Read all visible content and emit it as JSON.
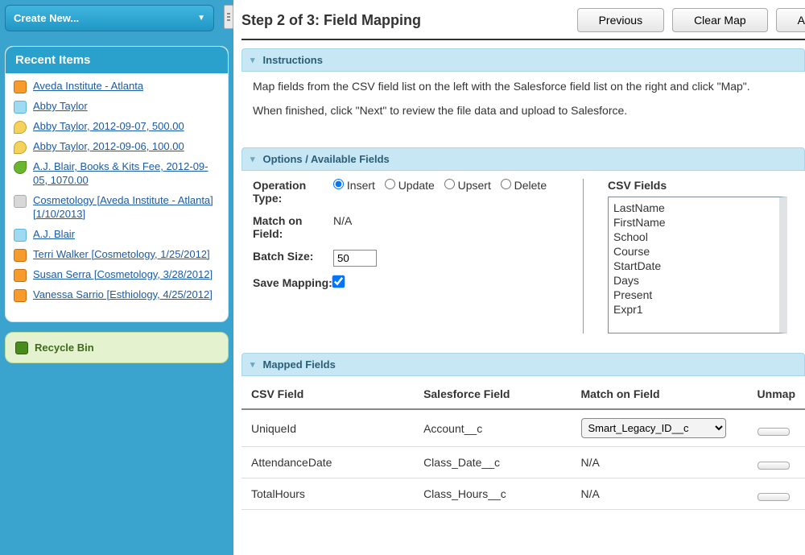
{
  "sidebar": {
    "create_label": "Create New...",
    "recent_header": "Recent Items",
    "items": [
      {
        "text": "Aveda Institute - Atlanta",
        "icon": "orange"
      },
      {
        "text": "Abby Taylor",
        "icon": "blue"
      },
      {
        "text": "Abby Taylor, 2012-09-07, 500.00",
        "icon": "yellow"
      },
      {
        "text": "Abby Taylor, 2012-09-06, 100.00",
        "icon": "yellow"
      },
      {
        "text": "A.J. Blair, Books & Kits Fee, 2012-09-05, 1070.00",
        "icon": "green"
      },
      {
        "text": "Cosmetology [Aveda Institute - Atlanta] [1/10/2013]",
        "icon": "gray"
      },
      {
        "text": "A.J. Blair",
        "icon": "blue"
      },
      {
        "text": "Terri Walker [Cosmetology, 1/25/2012]",
        "icon": "orange"
      },
      {
        "text": "Susan Serra [Cosmetology, 3/28/2012]",
        "icon": "orange"
      },
      {
        "text": "Vanessa Sarrio [Esthiology, 4/25/2012]",
        "icon": "orange"
      }
    ],
    "recycle_label": "Recycle Bin"
  },
  "header": {
    "step_title": "Step 2 of 3: Field Mapping",
    "previous_label": "Previous",
    "clear_label": "Clear Map",
    "action_label": "A"
  },
  "instructions": {
    "heading": "Instructions",
    "line1": "Map fields from the CSV field list on the left with the Salesforce field list on the right and click \"Map\".",
    "line2": "When finished, click \"Next\" to review the file data and upload to Salesforce."
  },
  "options": {
    "heading": "Options / Available Fields",
    "labels": {
      "operation_type": "Operation Type:",
      "match_on_field": "Match on Field:",
      "batch_size": "Batch Size:",
      "save_mapping": "Save Mapping:"
    },
    "radios": {
      "insert": "Insert",
      "update": "Update",
      "upsert": "Upsert",
      "delete": "Delete",
      "selected": "insert"
    },
    "match_on_value": "N/A",
    "batch_size_value": "50",
    "save_mapping_checked": true,
    "csv_heading": "CSV Fields",
    "csv_fields": [
      "LastName",
      "FirstName",
      "School",
      "Course",
      "StartDate",
      "Days",
      "Present",
      "Expr1"
    ]
  },
  "mapped": {
    "heading": "Mapped Fields",
    "columns": {
      "csv": "CSV Field",
      "sf": "Salesforce Field",
      "match": "Match on Field",
      "unmap": "Unmap"
    },
    "rows": [
      {
        "csv": "UniqueId",
        "sf": "Account__c",
        "match": "Smart_Legacy_ID__c",
        "has_select": true
      },
      {
        "csv": "AttendanceDate",
        "sf": "Class_Date__c",
        "match": "N/A",
        "has_select": false
      },
      {
        "csv": "TotalHours",
        "sf": "Class_Hours__c",
        "match": "N/A",
        "has_select": false
      }
    ]
  }
}
